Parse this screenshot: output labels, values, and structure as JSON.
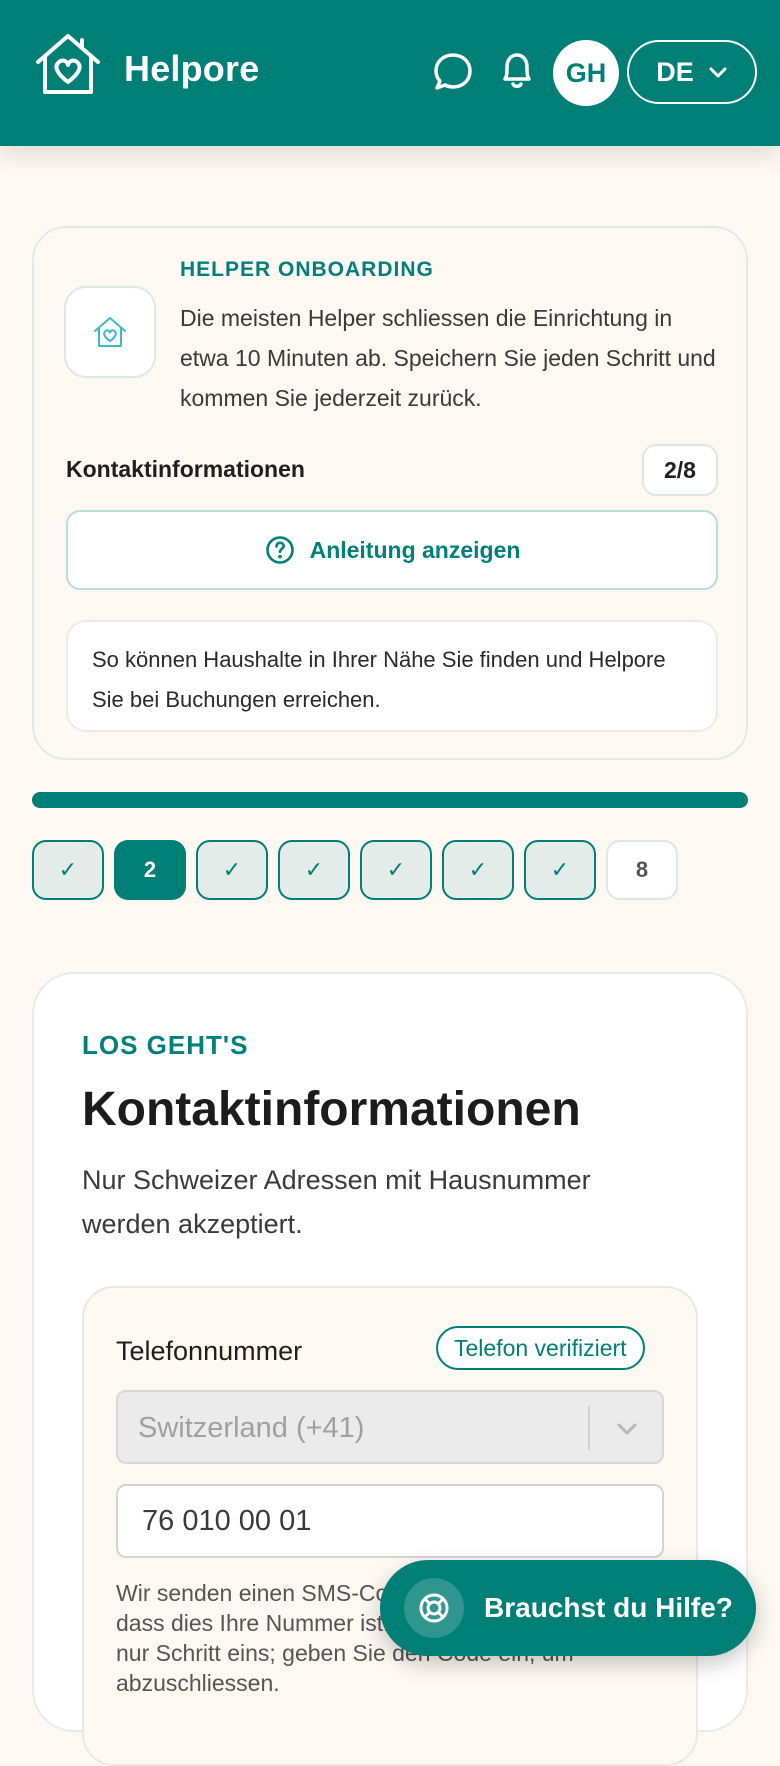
{
  "header": {
    "brand": "Helpore",
    "avatar_initials": "GH",
    "language": "DE",
    "icons": [
      "house-heart-icon",
      "chat-icon",
      "bell-icon",
      "chevron-down-icon"
    ]
  },
  "intro": {
    "eyebrow": "HELPER ONBOARDING",
    "text": "Die meisten Helper schliessen die Einrichtung in etwa 10 Minuten ab. Speichern Sie jeden Schritt und kommen Sie jederzeit zurück.",
    "step_title": "Kontaktinformationen",
    "step_count": "2/8",
    "guide_button": "Anleitung anzeigen",
    "note": "So können Haushalte in Ihrer Nähe Sie finden und Helpore Sie bei Buchungen erreichen."
  },
  "progress": {
    "fraction": 1.0
  },
  "steps": [
    {
      "label": "✓",
      "state": "done"
    },
    {
      "label": "2",
      "state": "current"
    },
    {
      "label": "✓",
      "state": "done"
    },
    {
      "label": "✓",
      "state": "done"
    },
    {
      "label": "✓",
      "state": "done"
    },
    {
      "label": "✓",
      "state": "done"
    },
    {
      "label": "✓",
      "state": "done"
    },
    {
      "label": "8",
      "state": "todo"
    }
  ],
  "form": {
    "eyebrow": "LOS GEHT'S",
    "title": "Kontaktinformationen",
    "subtitle": "Nur Schweizer Adressen mit Hausnummer werden akzeptiert.",
    "phone": {
      "label": "Telefonnummer",
      "badge": "Telefon verifiziert",
      "country": "Switzerland (+41)",
      "number": "76 010 00 01",
      "help": "Wir senden einen SMS-Code, um zu bestaetigen, dass dies Ihre Nummer ist. Die SMS zu erhalten ist nur Schritt eins; geben Sie den Code ein, um abzuschliessen."
    }
  },
  "help_fab": {
    "label": "Brauchst du Hilfe?",
    "icon": "lifebuoy-icon"
  },
  "colors": {
    "brand": "#007f77",
    "background": "#fdf8f2"
  }
}
